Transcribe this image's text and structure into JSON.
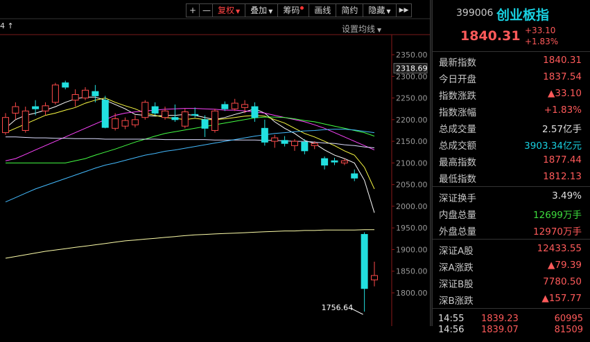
{
  "toolbar": {
    "zoom_in": "+",
    "zoom_out": "—",
    "fuquan": "复权",
    "overlay": "叠加",
    "chips": "筹码",
    "draw": "画线",
    "simple": "简约",
    "hide": "隐藏",
    "expand": "▶▶"
  },
  "chart_header": {
    "left_text": "4 ↑",
    "ma_settings": "设置均线"
  },
  "chart_data": {
    "type": "candlestick",
    "y_ticks": [
      "2350.00",
      "2300.00",
      "2250.00",
      "2200.00",
      "2150.00",
      "2100.00",
      "2050.00",
      "2000.00",
      "1950.00",
      "1900.00",
      "1850.00",
      "1800.00"
    ],
    "ylim": [
      1750,
      2370
    ],
    "current_price_label": "2318.69",
    "min_annotation": "1756.64",
    "candles": [
      {
        "o": 2170,
        "h": 2215,
        "l": 2165,
        "c": 2205
      },
      {
        "o": 2215,
        "h": 2240,
        "l": 2200,
        "c": 2230
      },
      {
        "o": 2175,
        "h": 2230,
        "l": 2170,
        "c": 2220
      },
      {
        "o": 2230,
        "h": 2245,
        "l": 2210,
        "c": 2225
      },
      {
        "o": 2220,
        "h": 2240,
        "l": 2210,
        "c": 2232
      },
      {
        "o": 2240,
        "h": 2285,
        "l": 2235,
        "c": 2280
      },
      {
        "o": 2285,
        "h": 2290,
        "l": 2270,
        "c": 2275
      },
      {
        "o": 2245,
        "h": 2270,
        "l": 2230,
        "c": 2258
      },
      {
        "o": 2250,
        "h": 2275,
        "l": 2245,
        "c": 2268
      },
      {
        "o": 2265,
        "h": 2280,
        "l": 2240,
        "c": 2255
      },
      {
        "o": 2245,
        "h": 2255,
        "l": 2180,
        "c": 2182
      },
      {
        "o": 2180,
        "h": 2215,
        "l": 2175,
        "c": 2202
      },
      {
        "o": 2185,
        "h": 2205,
        "l": 2178,
        "c": 2198
      },
      {
        "o": 2188,
        "h": 2210,
        "l": 2182,
        "c": 2200
      },
      {
        "o": 2205,
        "h": 2245,
        "l": 2200,
        "c": 2240
      },
      {
        "o": 2230,
        "h": 2240,
        "l": 2210,
        "c": 2215
      },
      {
        "o": 2205,
        "h": 2230,
        "l": 2200,
        "c": 2220
      },
      {
        "o": 2205,
        "h": 2235,
        "l": 2195,
        "c": 2200
      },
      {
        "o": 2185,
        "h": 2225,
        "l": 2180,
        "c": 2218
      },
      {
        "o": 2212,
        "h": 2228,
        "l": 2205,
        "c": 2210
      },
      {
        "o": 2200,
        "h": 2210,
        "l": 2160,
        "c": 2180
      },
      {
        "o": 2175,
        "h": 2225,
        "l": 2170,
        "c": 2220
      },
      {
        "o": 2235,
        "h": 2242,
        "l": 2220,
        "c": 2225
      },
      {
        "o": 2225,
        "h": 2248,
        "l": 2220,
        "c": 2238
      },
      {
        "o": 2228,
        "h": 2245,
        "l": 2215,
        "c": 2235
      },
      {
        "o": 2230,
        "h": 2240,
        "l": 2195,
        "c": 2205
      },
      {
        "o": 2180,
        "h": 2200,
        "l": 2140,
        "c": 2148
      },
      {
        "o": 2150,
        "h": 2165,
        "l": 2135,
        "c": 2158
      },
      {
        "o": 2152,
        "h": 2162,
        "l": 2138,
        "c": 2145
      },
      {
        "o": 2140,
        "h": 2155,
        "l": 2128,
        "c": 2150
      },
      {
        "o": 2148,
        "h": 2155,
        "l": 2120,
        "c": 2128
      },
      {
        "o": 2140,
        "h": 2150,
        "l": 2132,
        "c": 2145
      },
      {
        "o": 2110,
        "h": 2115,
        "l": 2085,
        "c": 2095
      },
      {
        "o": 2105,
        "h": 2112,
        "l": 2095,
        "c": 2102
      },
      {
        "o": 2100,
        "h": 2110,
        "l": 2095,
        "c": 2105
      },
      {
        "o": 2075,
        "h": 2085,
        "l": 2058,
        "c": 2065
      },
      {
        "o": 1935,
        "h": 1940,
        "l": 1756.64,
        "c": 1810
      },
      {
        "o": 1830,
        "h": 1872,
        "l": 1815,
        "c": 1840
      }
    ],
    "ma_lines": [
      {
        "color": "#ffffff",
        "values": [
          2180,
          2200,
          2210,
          2215,
          2222,
          2230,
          2240,
          2248,
          2252,
          2252,
          2245,
          2235,
          2225,
          2212,
          2210,
          2208,
          2210,
          2210,
          2212,
          2210,
          2205,
          2200,
          2205,
          2212,
          2218,
          2225,
          2215,
          2195,
          2180,
          2168,
          2152,
          2145,
          2130,
          2118,
          2110,
          2100,
          2060,
          1985
        ]
      },
      {
        "color": "#ffff44",
        "values": [
          2170,
          2180,
          2190,
          2200,
          2210,
          2215,
          2222,
          2228,
          2238,
          2245,
          2250,
          2240,
          2232,
          2225,
          2215,
          2210,
          2205,
          2203,
          2200,
          2203,
          2200,
          2200,
          2202,
          2205,
          2208,
          2210,
          2208,
          2200,
          2192,
          2180,
          2168,
          2160,
          2150,
          2140,
          2128,
          2118,
          2090,
          2040
        ]
      },
      {
        "color": "#ff44ff",
        "values": [
          2105,
          2110,
          2120,
          2130,
          2140,
          2150,
          2160,
          2170,
          2180,
          2190,
          2200,
          2210,
          2215,
          2218,
          2220,
          2222,
          2224,
          2225,
          2226,
          2226,
          2225,
          2224,
          2222,
          2222,
          2220,
          2218,
          2215,
          2210,
          2205,
          2200,
          2195,
          2188,
          2180,
          2170,
          2160,
          2150,
          2140,
          2130
        ]
      },
      {
        "color": "#44ff44",
        "values": [
          2100,
          2100,
          2100,
          2100,
          2100,
          2100,
          2100,
          2105,
          2110,
          2118,
          2125,
          2132,
          2140,
          2148,
          2155,
          2162,
          2168,
          2172,
          2176,
          2180,
          2184,
          2188,
          2192,
          2196,
          2200,
          2204,
          2206,
          2206,
          2205,
          2202,
          2198,
          2195,
          2190,
          2185,
          2180,
          2175,
          2170,
          2162
        ]
      },
      {
        "color": "#ddddff",
        "values": [
          2160,
          2160,
          2159,
          2158,
          2158,
          2157,
          2157,
          2156,
          2156,
          2156,
          2155,
          2155,
          2155,
          2155,
          2155,
          2155,
          2154,
          2154,
          2154,
          2154,
          2154,
          2153,
          2153,
          2153,
          2153,
          2153,
          2152,
          2152,
          2151,
          2150,
          2150,
          2148,
          2146,
          2145,
          2142,
          2140,
          2137,
          2135
        ]
      },
      {
        "color": "#44bbff",
        "values": [
          2010,
          2020,
          2030,
          2040,
          2048,
          2056,
          2064,
          2072,
          2080,
          2088,
          2095,
          2100,
          2106,
          2112,
          2118,
          2122,
          2127,
          2130,
          2134,
          2138,
          2142,
          2146,
          2150,
          2154,
          2158,
          2162,
          2165,
          2168,
          2170,
          2172,
          2174,
          2175,
          2177,
          2178,
          2178,
          2176,
          2173,
          2170
        ]
      },
      {
        "color": "#ffffaa",
        "values": [
          1880,
          1884,
          1888,
          1892,
          1896,
          1899,
          1902,
          1905,
          1908,
          1911,
          1914,
          1917,
          1920,
          1922,
          1924,
          1926,
          1928,
          1930,
          1932,
          1934,
          1935,
          1936,
          1937,
          1938,
          1939,
          1940,
          1941,
          1942,
          1943,
          1943,
          1944,
          1944,
          1945,
          1945,
          1945,
          1945,
          1946,
          1946
        ]
      }
    ]
  },
  "quote": {
    "code": "399006",
    "name": "创业板指",
    "price": "1840.31",
    "change": "+33.10",
    "change_pct": "+1.83%",
    "rows1": [
      {
        "label": "最新指数",
        "value": "1840.31",
        "color": "red"
      },
      {
        "label": "今日开盘",
        "value": "1837.54",
        "color": "red"
      },
      {
        "label": "指数涨跌",
        "value": "▲33.10",
        "color": "red"
      },
      {
        "label": "指数涨幅",
        "value": "+1.83%",
        "color": "red"
      },
      {
        "label": "总成交量",
        "value": "2.57亿手",
        "color": "white"
      },
      {
        "label": "总成交额",
        "value": "3903.34亿元",
        "color": "cyan"
      },
      {
        "label": "最高指数",
        "value": "1877.44",
        "color": "red"
      },
      {
        "label": "最低指数",
        "value": "1812.13",
        "color": "red"
      }
    ],
    "rows2": [
      {
        "label": "深证换手",
        "value": "3.49%",
        "color": "white"
      },
      {
        "label": "内盘总量",
        "value": "12699万手",
        "color": "green"
      },
      {
        "label": "外盘总量",
        "value": "12970万手",
        "color": "red"
      }
    ],
    "rows3": [
      {
        "label": "深证A股",
        "value": "12433.55",
        "color": "red"
      },
      {
        "label": "深A涨跌",
        "value": "▲79.39",
        "color": "red"
      },
      {
        "label": "深证B股",
        "value": "7780.50",
        "color": "red"
      },
      {
        "label": "深B涨跌",
        "value": "▲157.77",
        "color": "red"
      }
    ],
    "ticks": [
      {
        "time": "14:55",
        "price": "1839.23",
        "vol": "60995"
      },
      {
        "time": "14:56",
        "price": "1839.07",
        "vol": "81509"
      }
    ]
  }
}
